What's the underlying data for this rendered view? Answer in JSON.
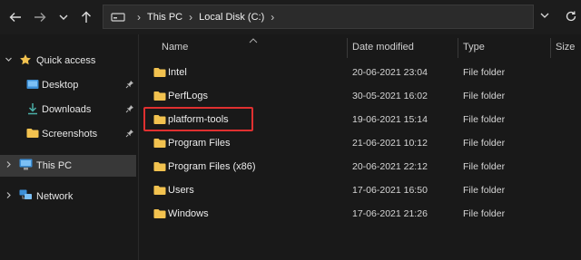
{
  "nav": {
    "back_icon": "arrow-left-icon",
    "forward_icon": "arrow-right-icon",
    "recent_icon": "chevron-down-icon",
    "up_icon": "arrow-up-icon"
  },
  "address": {
    "drive_icon": "drive-icon",
    "crumbs": [
      "This PC",
      "Local Disk (C:)"
    ],
    "dropdown_icon": "chevron-down-icon",
    "refresh_icon": "refresh-icon"
  },
  "sidebar": {
    "quick_access": "Quick access",
    "items": [
      {
        "label": "Desktop",
        "icon": "desktop-icon",
        "pinned": true
      },
      {
        "label": "Downloads",
        "icon": "download-icon",
        "pinned": true
      },
      {
        "label": "Screenshots",
        "icon": "folder-icon",
        "pinned": true
      }
    ],
    "this_pc": "This PC",
    "network": "Network"
  },
  "columns": {
    "name": "Name",
    "date_modified": "Date modified",
    "type": "Type",
    "size": "Size"
  },
  "files": [
    {
      "name": "Intel",
      "date": "20-06-2021 23:04",
      "type": "File folder"
    },
    {
      "name": "PerfLogs",
      "date": "30-05-2021 16:02",
      "type": "File folder"
    },
    {
      "name": "platform-tools",
      "date": "19-06-2021 15:14",
      "type": "File folder"
    },
    {
      "name": "Program Files",
      "date": "21-06-2021 10:12",
      "type": "File folder"
    },
    {
      "name": "Program Files (x86)",
      "date": "20-06-2021 22:12",
      "type": "File folder"
    },
    {
      "name": "Users",
      "date": "17-06-2021 16:50",
      "type": "File folder"
    },
    {
      "name": "Windows",
      "date": "17-06-2021 21:26",
      "type": "File folder"
    }
  ],
  "colors": {
    "folder": "#f2c24f",
    "highlight": "#e03030",
    "selected_bg": "#383838"
  }
}
